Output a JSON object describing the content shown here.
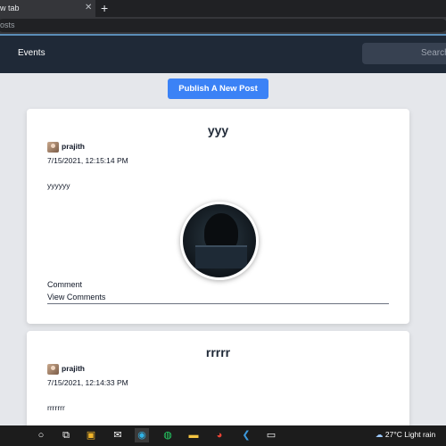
{
  "browser": {
    "tab_title": "w tab",
    "address_text": "osts"
  },
  "nav": {
    "events_label": "Events",
    "search_placeholder": "Search"
  },
  "actions": {
    "publish_label": "Publish A New Post"
  },
  "posts": [
    {
      "title": "yyy",
      "author": "prajith",
      "date": "7/15/2021, 12:15:14 PM",
      "body": "yyyyyy",
      "comment_label": "Comment",
      "view_comments_label": "View Comments"
    },
    {
      "title": "rrrrr",
      "author": "prajith",
      "date": "7/15/2021, 12:14:33 PM",
      "body": "rrrrrrr"
    }
  ],
  "taskbar": {
    "icons": [
      "search-icon",
      "task-view-icon",
      "store-icon",
      "mail-icon",
      "edge-icon",
      "whatsapp-icon",
      "file-explorer-icon",
      "chrome-icon",
      "vscode-icon",
      "terminal-icon"
    ],
    "weather_text": "27°C  Light rain"
  },
  "colors": {
    "nav_bg": "#1f2937",
    "accent": "#3b82f6",
    "page_bg": "#e5e7eb"
  }
}
